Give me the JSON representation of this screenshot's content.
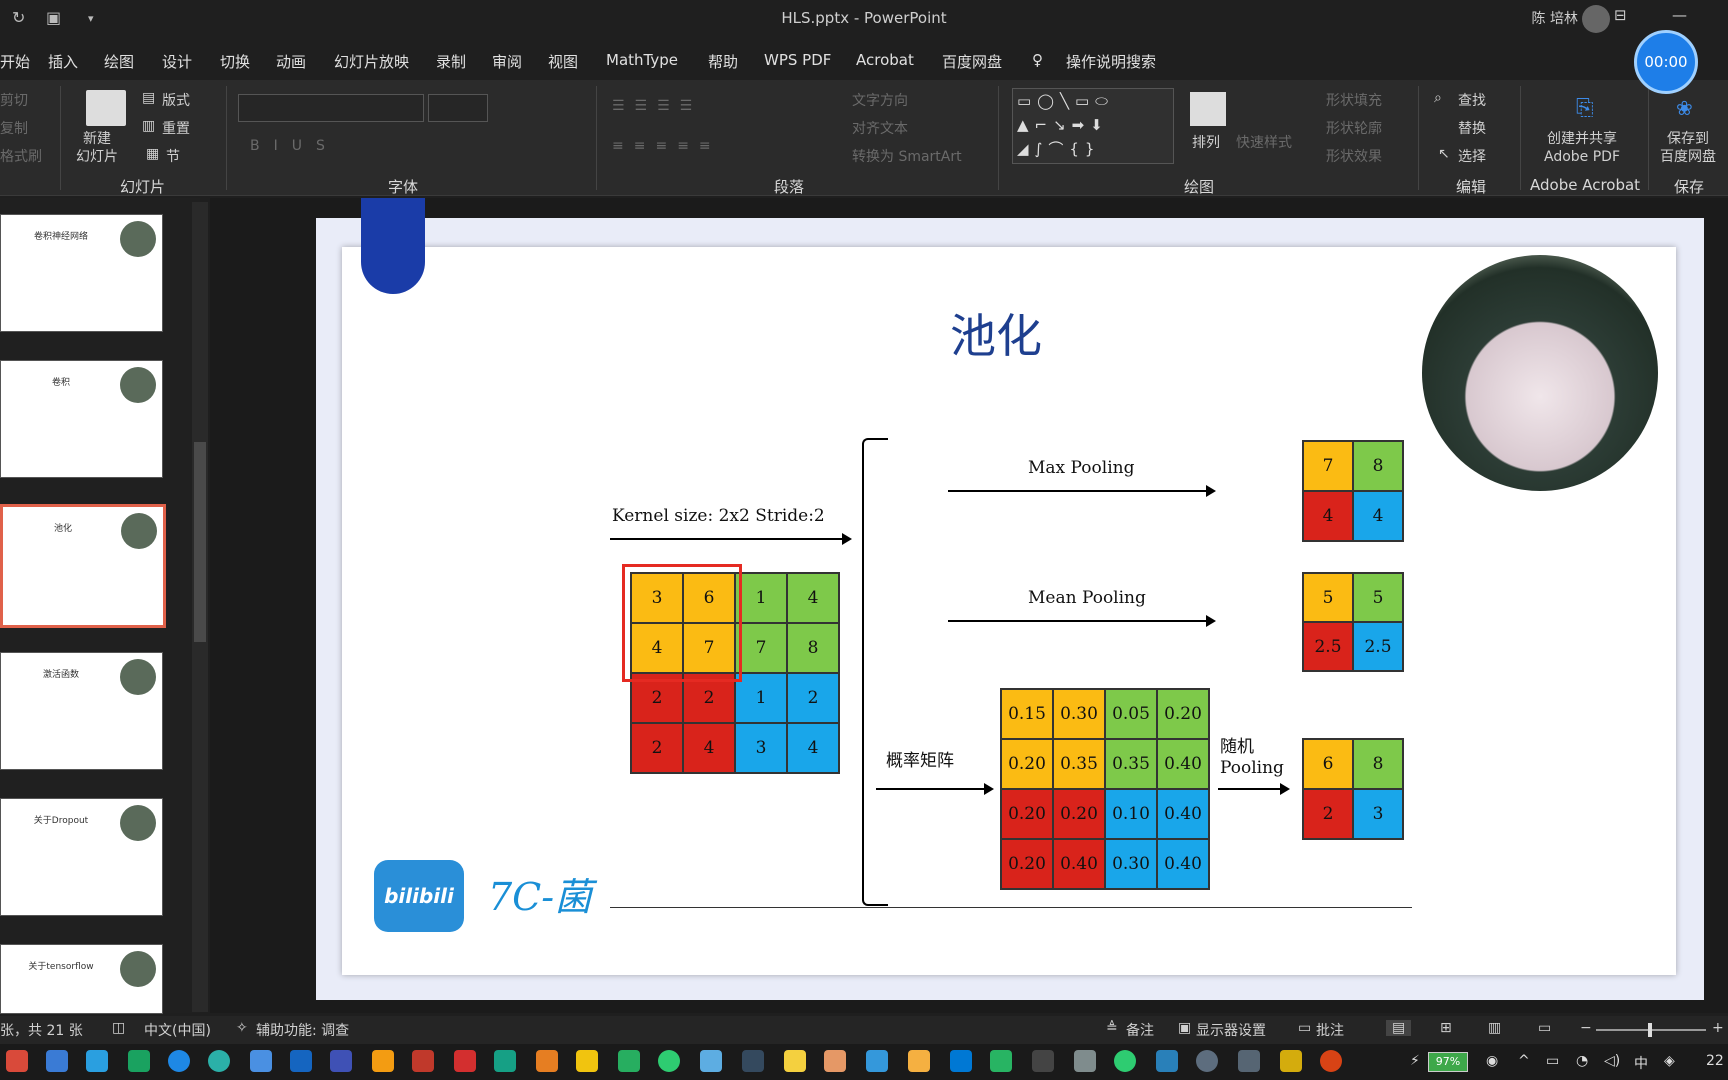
{
  "window": {
    "title": "HLS.pptx  -  PowerPoint",
    "user": "陈 培林",
    "timer": "00:00"
  },
  "menu": [
    "开始",
    "插入",
    "绘图",
    "设计",
    "切换",
    "动画",
    "幻灯片放映",
    "录制",
    "审阅",
    "视图",
    "MathType",
    "帮助",
    "WPS PDF",
    "Acrobat",
    "百度网盘",
    "操作说明搜索"
  ],
  "ribbon": {
    "clipboard": [
      "剪切",
      "复制",
      "格式刷"
    ],
    "slides": {
      "new_slide": "新建\n幻灯片",
      "layout": "版式",
      "reset": "重置",
      "section": "节",
      "group": "幻灯片"
    },
    "font_group": "字体",
    "paragraph": {
      "text_direction": "文字方向",
      "align_text": "对齐文本",
      "smartart": "转换为 SmartArt",
      "group": "段落"
    },
    "drawing": {
      "arrange": "排列",
      "quick_styles": "快速样式",
      "fill": "形状填充",
      "outline": "形状轮廓",
      "effects": "形状效果",
      "group": "绘图"
    },
    "editing": {
      "find": "查找",
      "replace": "替换",
      "select": "选择",
      "group": "编辑"
    },
    "acrobat": {
      "create": "创建并共享\nAdobe PDF",
      "group": "Adobe Acrobat"
    },
    "save": {
      "label": "保存到\n百度网盘",
      "group": "保存"
    }
  },
  "thumbnails": [
    {
      "title": "卷积神经网络",
      "selected": false
    },
    {
      "title": "卷积",
      "selected": false
    },
    {
      "title": "池化",
      "selected": true
    },
    {
      "title": "激活函数",
      "selected": false
    },
    {
      "title": "关于Dropout",
      "selected": false
    },
    {
      "title": "关于tensorflow",
      "selected": false
    }
  ],
  "slide": {
    "title": "池化",
    "kernel_label": "Kernel size: 2x2 Stride:2",
    "input_grid": [
      [
        "3",
        "6",
        "1",
        "4"
      ],
      [
        "4",
        "7",
        "7",
        "8"
      ],
      [
        "2",
        "2",
        "1",
        "2"
      ],
      [
        "2",
        "4",
        "3",
        "4"
      ]
    ],
    "max_pooling": {
      "label": "Max Pooling",
      "result": [
        [
          "7",
          "8"
        ],
        [
          "4",
          "4"
        ]
      ]
    },
    "mean_pooling": {
      "label": "Mean Pooling",
      "result": [
        [
          "5",
          "5"
        ],
        [
          "2.5",
          "2.5"
        ]
      ]
    },
    "prob_label": "概率矩阵",
    "prob_grid": [
      [
        "0.15",
        "0.30",
        "0.05",
        "0.20"
      ],
      [
        "0.20",
        "0.35",
        "0.35",
        "0.40"
      ],
      [
        "0.20",
        "0.20",
        "0.10",
        "0.40"
      ],
      [
        "0.20",
        "0.40",
        "0.30",
        "0.40"
      ]
    ],
    "random_pooling": {
      "label_line1": "随机",
      "label_line2": "Pooling",
      "result": [
        [
          "6",
          "8"
        ],
        [
          "2",
          "3"
        ]
      ]
    },
    "logo_text": "bilibili",
    "signature": "7C-菌"
  },
  "status": {
    "slide_count": "张，共 21 张",
    "language": "中文(中国)",
    "accessibility": "辅助功能: 调查",
    "notes": "备注",
    "display": "显示器设置",
    "comments": "批注"
  },
  "taskbar": {
    "battery": "97%",
    "ime": "中",
    "time": "22"
  }
}
